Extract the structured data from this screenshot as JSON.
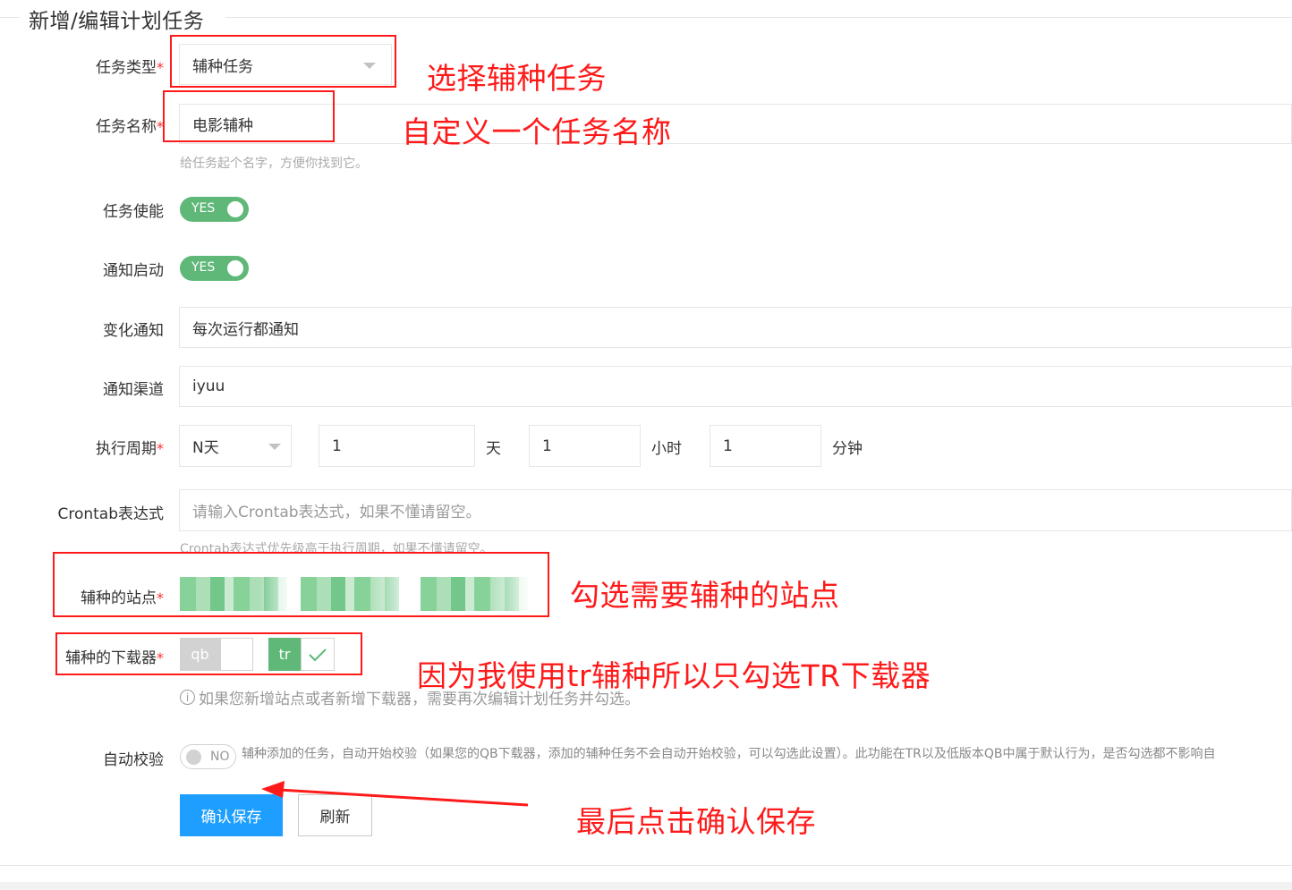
{
  "form": {
    "legend": "新增/编辑计划任务",
    "required_mark": "*",
    "task_type": {
      "label": "任务类型",
      "value": "辅种任务"
    },
    "task_name": {
      "label": "任务名称",
      "value": "电影辅种",
      "hint": "给任务起个名字，方便你找到它。"
    },
    "task_enable": {
      "label": "任务使能",
      "switch_text": "YES",
      "on": true
    },
    "notify_start": {
      "label": "通知启动",
      "switch_text": "YES",
      "on": true
    },
    "change_notify": {
      "label": "变化通知",
      "value": "每次运行都通知"
    },
    "notify_channel": {
      "label": "通知渠道",
      "value": "iyuu"
    },
    "period": {
      "label": "执行周期",
      "mode": "N天",
      "days": "1",
      "days_unit": "天",
      "hours": "1",
      "hours_unit": "小时",
      "minutes": "1",
      "minutes_unit": "分钟"
    },
    "crontab": {
      "label": "Crontab表达式",
      "placeholder": "请输入Crontab表达式，如果不懂请留空。",
      "hint": "Crontab表达式优先级高于执行周期，如果不懂请留空。"
    },
    "sites": {
      "label": "辅种的站点"
    },
    "downloaders": {
      "label": "辅种的下载器",
      "items": [
        {
          "name": "qb",
          "checked": false
        },
        {
          "name": "tr",
          "checked": true
        }
      ],
      "info": "如果您新增站点或者新增下载器，需要再次编辑计划任务并勾选。"
    },
    "auto_check": {
      "label": "自动校验",
      "switch_text": "NO",
      "on": false,
      "desc": "辅种添加的任务，自动开始校验（如果您的QB下载器，添加的辅种任务不会自动开始校验，可以勾选此设置）。此功能在TR以及低版本QB中属于默认行为，是否勾选都不影响自"
    },
    "buttons": {
      "confirm": "确认保存",
      "refresh": "刷新"
    }
  },
  "annotations": {
    "select_type": "选择辅种任务",
    "custom_name": "自定义一个任务名称",
    "check_sites": "勾选需要辅种的站点",
    "tr_only": "因为我使用tr辅种所以只勾选TR下载器",
    "finally_save": "最后点击确认保存"
  },
  "colors": {
    "switch_on": "#5fb878",
    "primary_button": "#1e9fff",
    "annotation_red": "#ff1a1a",
    "required_red": "#ff2d2d"
  }
}
